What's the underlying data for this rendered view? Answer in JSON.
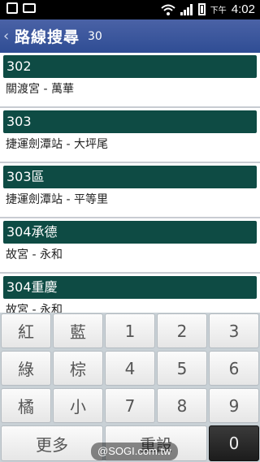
{
  "status": {
    "ampm": "下午",
    "time": "4:02"
  },
  "header": {
    "back_icon": "‹",
    "title": "路線搜尋",
    "count": "30"
  },
  "routes": [
    {
      "number": "302",
      "desc": "關渡宮 - 萬華"
    },
    {
      "number": "303",
      "desc": "捷運劍潭站 - 大坪尾"
    },
    {
      "number": "303區",
      "desc": "捷運劍潭站 - 平等里"
    },
    {
      "number": "304承德",
      "desc": "故宮 - 永和"
    },
    {
      "number": "304重慶",
      "desc": "故宮 - 永和"
    }
  ],
  "keys": {
    "r1": [
      "紅",
      "藍",
      "1",
      "2",
      "3"
    ],
    "r2": [
      "綠",
      "棕",
      "4",
      "5",
      "6"
    ],
    "r3": [
      "橘",
      "小",
      "7",
      "8",
      "9"
    ],
    "more": "更多",
    "reset": "重設",
    "zero": "0"
  },
  "watermark": "@SOGI.com.tw"
}
